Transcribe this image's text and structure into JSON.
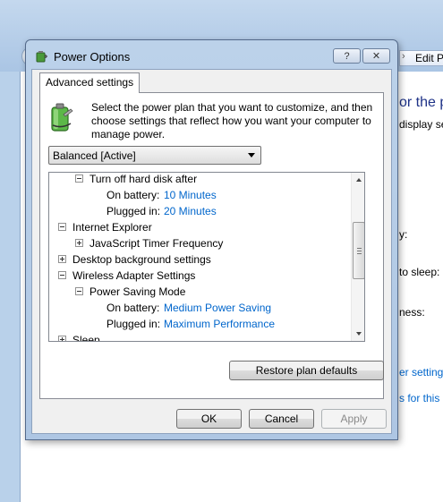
{
  "background_window": {
    "nav_text": "Edit P",
    "heading": "or the p",
    "lines": [
      "display se",
      "y:",
      "to sleep:",
      "ness:"
    ],
    "links": [
      "er setting",
      "s for this p"
    ]
  },
  "dialog": {
    "title": "Power Options",
    "help_label": "?",
    "close_label": "✕",
    "tab_label": "Advanced settings",
    "intro_text": "Select the power plan that you want to customize, and then choose settings that reflect how you want your computer to manage power.",
    "plan_select_value": "Balanced [Active]",
    "tree": [
      {
        "level": 1,
        "toggle": "minus",
        "label": "Turn off hard disk after"
      },
      {
        "level": 2,
        "label": "On battery:",
        "value": "10 Minutes"
      },
      {
        "level": 2,
        "label": "Plugged in:",
        "value": "20 Minutes"
      },
      {
        "level": 0,
        "toggle": "minus",
        "label": "Internet Explorer"
      },
      {
        "level": 1,
        "toggle": "plus",
        "label": "JavaScript Timer Frequency"
      },
      {
        "level": 0,
        "toggle": "plus",
        "label": "Desktop background settings"
      },
      {
        "level": 0,
        "toggle": "minus",
        "label": "Wireless Adapter Settings"
      },
      {
        "level": 1,
        "toggle": "minus",
        "label": "Power Saving Mode"
      },
      {
        "level": 2,
        "label": "On battery:",
        "value": "Medium Power Saving"
      },
      {
        "level": 2,
        "label": "Plugged in:",
        "value": "Maximum Performance"
      },
      {
        "level": 0,
        "toggle": "plus",
        "label": "Sleep"
      }
    ],
    "restore_label": "Restore plan defaults",
    "ok_label": "OK",
    "cancel_label": "Cancel",
    "apply_label": "Apply"
  },
  "colors": {
    "link_blue": "#0066cc",
    "dialog_frame": "#b9d1ea",
    "heading_blue": "#1e3287"
  },
  "icons": {
    "title_icon": "power-options-icon",
    "plan_icon": "battery-plug-icon"
  }
}
